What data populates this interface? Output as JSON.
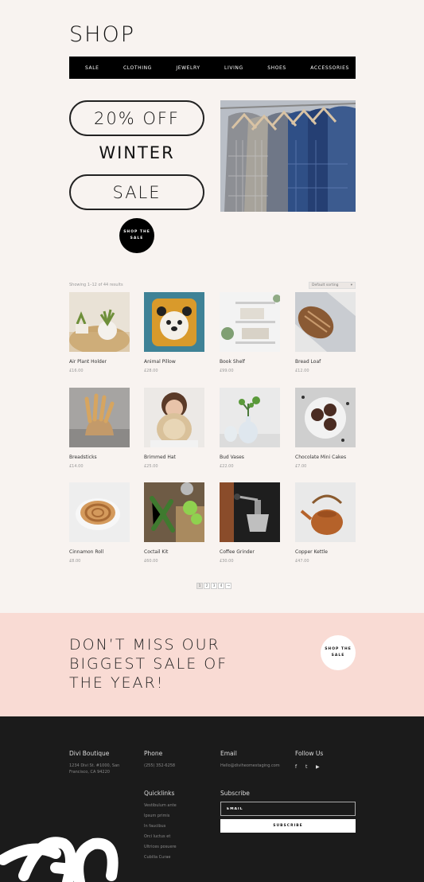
{
  "page": {
    "title": "SHOP"
  },
  "nav": {
    "items": [
      "SALE",
      "CLOTHING",
      "JEWELRY",
      "LIVING",
      "SHOES",
      "ACCESSORIES"
    ]
  },
  "hero": {
    "line1": "20% OFF",
    "line2": "WINTER",
    "line3": "SALE",
    "cta_line1": "SHOP THE",
    "cta_line2": "SALE"
  },
  "catalog": {
    "results_text": "Showing 1–12 of 44 results",
    "sort_value": "Default sorting",
    "products": [
      {
        "name": "Air Plant Holder",
        "price": "£16.00"
      },
      {
        "name": "Animal Pillow",
        "price": "£28.00"
      },
      {
        "name": "Book Shelf",
        "price": "£99.00"
      },
      {
        "name": "Bread Loaf",
        "price": "£12.00"
      },
      {
        "name": "Breadsticks",
        "price": "£14.00"
      },
      {
        "name": "Brimmed Hat",
        "price": "£25.00"
      },
      {
        "name": "Bud Vases",
        "price": "£22.00"
      },
      {
        "name": "Chocolate Mini Cakes",
        "price": "£7.00"
      },
      {
        "name": "Cinnamon Roll",
        "price": "£8.00"
      },
      {
        "name": "Coctail Kit",
        "price": "£60.00"
      },
      {
        "name": "Coffee Grinder",
        "price": "£30.00"
      },
      {
        "name": "Copper Kettle",
        "price": "£47.00"
      }
    ],
    "pagination": [
      "1",
      "2",
      "3",
      "4",
      "→"
    ]
  },
  "promo": {
    "headline": "DON’T MISS OUR BIGGEST SALE OF THE YEAR!",
    "cta_line1": "SHOP THE",
    "cta_line2": "SALE"
  },
  "footer": {
    "brand": "Divi Boutique",
    "address": "1234 Divi St. #1000, San Francisco, CA 94220",
    "phone_heading": "Phone",
    "phone": "(255) 352-6258",
    "email_heading": "Email",
    "email": "Hello@diviheomestaging.com",
    "follow_heading": "Follow Us",
    "quicklinks_heading": "Quicklinks",
    "quicklinks": [
      "Vestibulum ante",
      "Ipsum primis",
      "In faucibus",
      "Orci luctus et",
      "Ultrices posuere",
      "Cubilia Curae"
    ],
    "subscribe_heading": "Subscribe",
    "email_placeholder": "EMAIL",
    "subscribe_label": "SUBSCRIBE",
    "social_icons": [
      "facebook-icon",
      "twitter-icon",
      "youtube-icon"
    ]
  }
}
